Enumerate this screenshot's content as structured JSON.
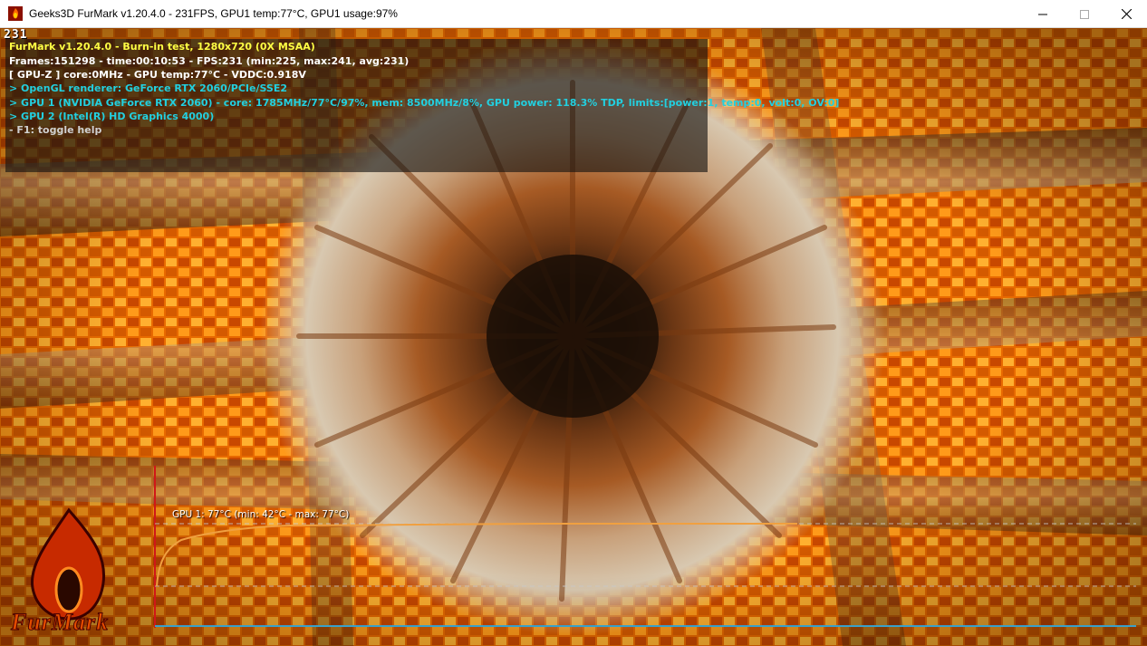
{
  "window": {
    "title": "Geeks3D FurMark v1.20.4.0 - 231FPS, GPU1 temp:77°C, GPU1 usage:97%",
    "icon": "furmark-app-icon"
  },
  "overlay": {
    "fps_counter": "231",
    "lines": [
      "FurMark v1.20.4.0 - Burn-in test, 1280x720 (0X MSAA)",
      "Frames:151298 - time:00:10:53 - FPS:231 (min:225, max:241, avg:231)",
      "[ GPU-Z ] core:0MHz - GPU temp:77°C - VDDC:0.918V",
      "> OpenGL renderer: GeForce RTX 2060/PCIe/SSE2",
      "> GPU 1 (NVIDIA GeForce RTX 2060) - core: 1785MHz/77°C/97%, mem: 8500MHz/8%, GPU power: 118.3% TDP, limits:[power:1, temp:0, volt:0, OV:0]",
      "> GPU 2 (Intel(R) HD Graphics 4000)",
      "- F1: toggle help"
    ]
  },
  "graph": {
    "label": "GPU 1: 77°C (min: 42°C - max: 77°C)",
    "min_temp": 42,
    "max_temp": 77,
    "current_temp": 77
  },
  "logo": {
    "text": "FurMark"
  },
  "colors": {
    "line_yellow": "#ffff44",
    "line_white": "#ffffff",
    "line_cyan": "#22d0e0",
    "graph_curve": "#f0a040",
    "graph_axis": "#3aa0c8"
  }
}
